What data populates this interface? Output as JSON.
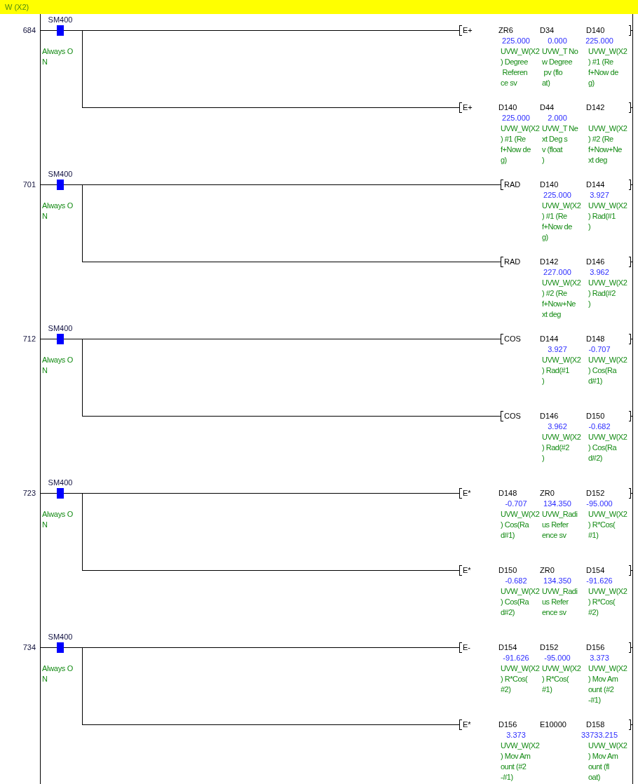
{
  "statement": {
    "text": "W (X2)"
  },
  "rungs": [
    {
      "step": "684",
      "contact": {
        "device": "SM400",
        "on": true,
        "comment": "Always O\nN"
      },
      "outputs": [
        {
          "instruction": "E+",
          "operands": [
            {
              "device": "ZR6",
              "value": "225.000",
              "comment": "UVW_W(X2\n) Degree\n Referen\nce sv"
            },
            {
              "device": "D34",
              "value": "0.000",
              "comment": "UVW_T No\nw Degree\n pv (flo\nat)"
            },
            {
              "device": "D140",
              "value": "225.000",
              "comment": "UVW_W(X2\n) #1 (Re\nf+Now de\ng)"
            }
          ]
        },
        {
          "instruction": "E+",
          "operands": [
            {
              "device": "D140",
              "value": "225.000",
              "comment": "UVW_W(X2\n) #1 (Re\nf+Now de\ng)"
            },
            {
              "device": "D44",
              "value": "2.000",
              "comment": "UVW_T Ne\nxt Deg s\nv (float\n)"
            },
            {
              "device": "D142",
              "comment": "UVW_W(X2\n) #2 (Re\nf+Now+Ne\nxt deg"
            }
          ]
        }
      ]
    },
    {
      "step": "701",
      "contact": {
        "device": "SM400",
        "on": true,
        "comment": "Always O\nN"
      },
      "outputs": [
        {
          "instruction": "RAD",
          "operands": [
            {
              "device": "D140",
              "value": "225.000",
              "comment": "UVW_W(X2\n) #1 (Re\nf+Now de\ng)"
            },
            {
              "device": "D144",
              "value": "3.927",
              "comment": "UVW_W(X2\n) Rad(#1\n)"
            }
          ]
        },
        {
          "instruction": "RAD",
          "operands": [
            {
              "device": "D142",
              "value": "227.000",
              "comment": "UVW_W(X2\n) #2 (Re\nf+Now+Ne\nxt deg"
            },
            {
              "device": "D146",
              "value": "3.962",
              "comment": "UVW_W(X2\n) Rad(#2\n)"
            }
          ]
        }
      ]
    },
    {
      "step": "712",
      "contact": {
        "device": "SM400",
        "on": true,
        "comment": "Always O\nN"
      },
      "outputs": [
        {
          "instruction": "COS",
          "operands": [
            {
              "device": "D144",
              "value": "3.927",
              "comment": "UVW_W(X2\n) Rad(#1\n)"
            },
            {
              "device": "D148",
              "value": "-0.707",
              "comment": "UVW_W(X2\n) Cos(Ra\nd#1)"
            }
          ]
        },
        {
          "instruction": "COS",
          "operands": [
            {
              "device": "D146",
              "value": "3.962",
              "comment": "UVW_W(X2\n) Rad(#2\n)"
            },
            {
              "device": "D150",
              "value": "-0.682",
              "comment": "UVW_W(X2\n) Cos(Ra\nd#2)"
            }
          ]
        }
      ]
    },
    {
      "step": "723",
      "contact": {
        "device": "SM400",
        "on": true,
        "comment": "Always O\nN"
      },
      "outputs": [
        {
          "instruction": "E*",
          "operands": [
            {
              "device": "D148",
              "value": "-0.707",
              "comment": "UVW_W(X2\n) Cos(Ra\nd#1)"
            },
            {
              "device": "ZR0",
              "value": "134.350",
              "comment": "UVW_Radi\nus Refer\nence sv"
            },
            {
              "device": "D152",
              "value": "-95.000",
              "comment": "UVW_W(X2\n) R*Cos(\n#1)"
            }
          ]
        },
        {
          "instruction": "E*",
          "operands": [
            {
              "device": "D150",
              "value": "-0.682",
              "comment": "UVW_W(X2\n) Cos(Ra\nd#2)"
            },
            {
              "device": "ZR0",
              "value": "134.350",
              "comment": "UVW_Radi\nus Refer\nence sv"
            },
            {
              "device": "D154",
              "value": "-91.626",
              "comment": "UVW_W(X2\n) R*Cos(\n#2)"
            }
          ]
        }
      ]
    },
    {
      "step": "734",
      "contact": {
        "device": "SM400",
        "on": true,
        "comment": "Always O\nN"
      },
      "outputs": [
        {
          "instruction": "E-",
          "operands": [
            {
              "device": "D154",
              "value": "-91.626",
              "comment": "UVW_W(X2\n) R*Cos(\n#2)"
            },
            {
              "device": "D152",
              "value": "-95.000",
              "comment": "UVW_W(X2\n) R*Cos(\n#1)"
            },
            {
              "device": "D156",
              "value": "3.373",
              "comment": "UVW_W(X2\n) Mov Am\nount (#2\n-#1)"
            }
          ]
        },
        {
          "instruction": "E*",
          "operands": [
            {
              "device": "D156",
              "value": "3.373",
              "comment": "UVW_W(X2\n) Mov Am\nount (#2\n-#1)"
            },
            {
              "device": "E10000"
            },
            {
              "device": "D158",
              "value": "33733.215",
              "comment": "UVW_W(X2\n) Mov Am\nount (fl\noat)"
            }
          ]
        }
      ]
    }
  ]
}
